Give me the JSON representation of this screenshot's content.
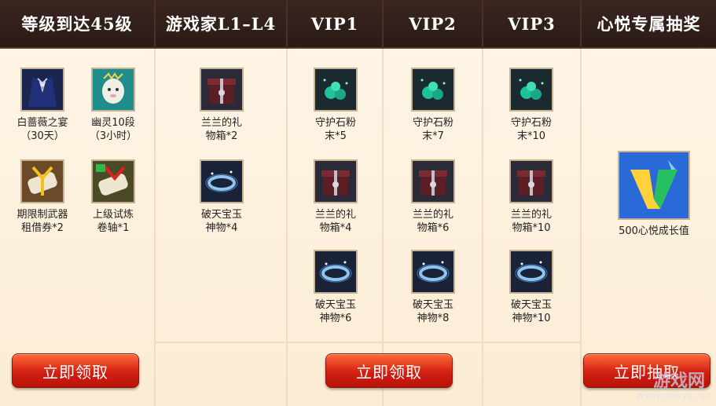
{
  "headers": [
    "等级到达45级",
    "游戏家L1–L4",
    "VIP1",
    "VIP2",
    "VIP3",
    "心悦专属抽奖"
  ],
  "col1": [
    {
      "icon": "suit-icon",
      "label1": "白蔷薇之宴",
      "label2": "（30天）"
    },
    {
      "icon": "ghost-icon",
      "label1": "幽灵10段",
      "label2": "（3小时）"
    },
    {
      "icon": "scroll-weapon-icon",
      "label1": "期限制武器",
      "label2": "租借券*2"
    },
    {
      "icon": "scroll-trial-icon",
      "label1": "上级试炼",
      "label2": "卷轴*1"
    }
  ],
  "col2": [
    {
      "icon": "gift-box-icon",
      "label1": "兰兰的礼",
      "label2": "物箱*2"
    },
    {
      "icon": "jade-ring-icon",
      "label1": "破天宝玉",
      "label2": "神物*4"
    }
  ],
  "vip1": [
    {
      "icon": "gem-powder-icon",
      "label1": "守护石粉",
      "label2": "末*5"
    },
    {
      "icon": "gift-box-icon",
      "label1": "兰兰的礼",
      "label2": "物箱*4"
    },
    {
      "icon": "jade-ring-icon",
      "label1": "破天宝玉",
      "label2": "神物*6"
    }
  ],
  "vip2": [
    {
      "icon": "gem-powder-icon",
      "label1": "守护石粉",
      "label2": "末*7"
    },
    {
      "icon": "gift-box-icon",
      "label1": "兰兰的礼",
      "label2": "物箱*6"
    },
    {
      "icon": "jade-ring-icon",
      "label1": "破天宝玉",
      "label2": "神物*8"
    }
  ],
  "vip3": [
    {
      "icon": "gem-powder-icon",
      "label1": "守护石粉",
      "label2": "末*10"
    },
    {
      "icon": "gift-box-icon",
      "label1": "兰兰的礼",
      "label2": "物箱*10"
    },
    {
      "icon": "jade-ring-icon",
      "label1": "破天宝玉",
      "label2": "神物*10"
    }
  ],
  "col6": {
    "icon": "vip-growth-icon",
    "label": "500心悦成长值"
  },
  "buttons": {
    "claim1": "立即领取",
    "claim2": "立即领取",
    "draw": "立即抽取"
  },
  "watermark": {
    "logo": "游戏网",
    "url": "www.newyx.net"
  }
}
